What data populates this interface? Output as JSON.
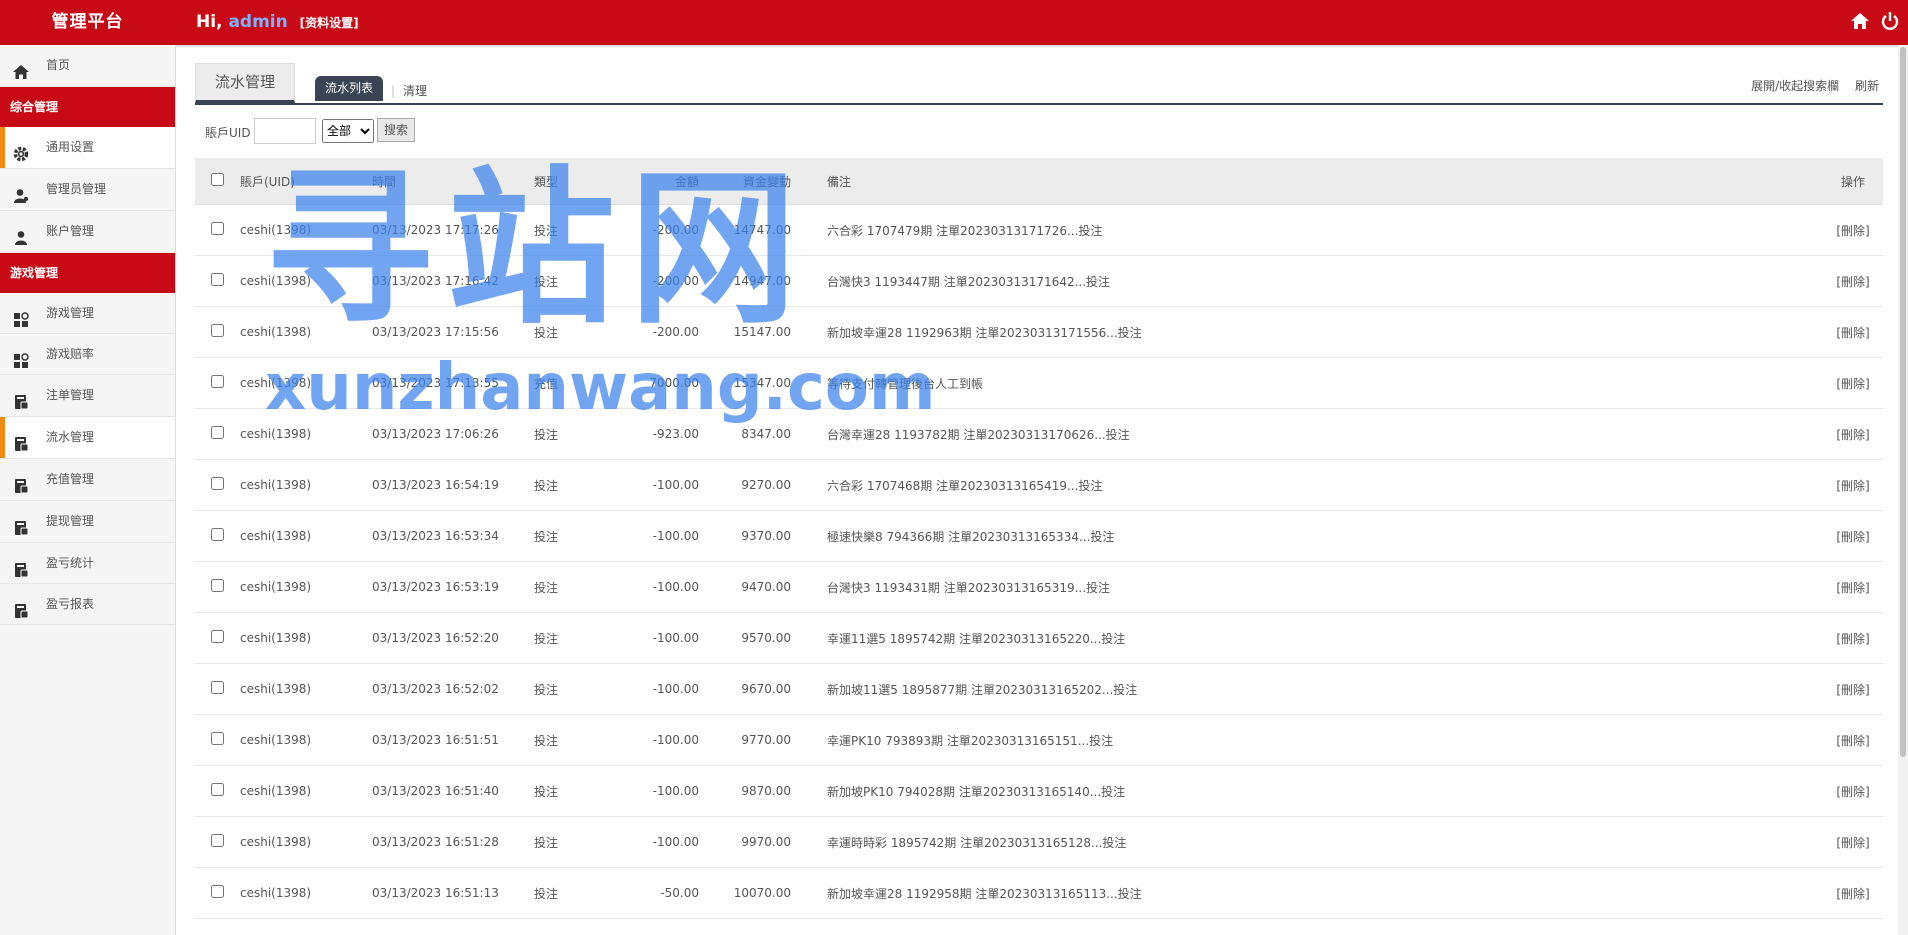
{
  "header": {
    "brand": "管理平台",
    "greeting": "Hi,",
    "user": "admin",
    "profile_link": "[资料设置]"
  },
  "sidebar": {
    "home": "首页",
    "section1": "综合管理",
    "items1": [
      {
        "label": "通用设置",
        "icon": "gear-icon"
      },
      {
        "label": "管理员管理",
        "icon": "user-icon"
      },
      {
        "label": "账户管理",
        "icon": "user-icon"
      }
    ],
    "section2": "游戏管理",
    "items2": [
      {
        "label": "游戏管理",
        "icon": "apps-icon"
      },
      {
        "label": "游戏赔率",
        "icon": "apps-icon"
      },
      {
        "label": "注单管理",
        "icon": "ledger-icon"
      },
      {
        "label": "流水管理",
        "icon": "ledger-icon"
      },
      {
        "label": "充值管理",
        "icon": "ledger-icon"
      },
      {
        "label": "提现管理",
        "icon": "ledger-icon"
      },
      {
        "label": "盈亏统计",
        "icon": "ledger-icon"
      },
      {
        "label": "盈亏报表",
        "icon": "ledger-icon"
      }
    ],
    "active": "流水管理"
  },
  "tabs": {
    "main": "流水管理",
    "sub": "流水列表",
    "clean": "清理",
    "toggle_search": "展開/收起搜索欄",
    "refresh": "刷新"
  },
  "search": {
    "label": "賬戶UID",
    "input_value": "",
    "select_value": "全部",
    "button": "搜索"
  },
  "table": {
    "headers": {
      "account": "賬戶(UID)",
      "time": "時間",
      "type": "類型",
      "amount": "金額",
      "balance": "資金變動",
      "note": "備注",
      "op": "操作"
    },
    "rows": [
      {
        "account": "ceshi(1398)",
        "time": "03/13/2023 17:17:26",
        "type": "投注",
        "amount": "-200.00",
        "balance": "14747.00",
        "note": "六合彩 1707479期 注單20230313171726...投注",
        "op": "[刪除]"
      },
      {
        "account": "ceshi(1398)",
        "time": "03/13/2023 17:16:42",
        "type": "投注",
        "amount": "-200.00",
        "balance": "14947.00",
        "note": "台灣快3 1193447期 注單20230313171642...投注",
        "op": "[刪除]"
      },
      {
        "account": "ceshi(1398)",
        "time": "03/13/2023 17:15:56",
        "type": "投注",
        "amount": "-200.00",
        "balance": "15147.00",
        "note": "新加坡幸運28 1192963期 注單20230313171556...投注",
        "op": "[刪除]"
      },
      {
        "account": "ceshi(1398)",
        "time": "03/13/2023 17:13:55",
        "type": "充值",
        "amount": "7000.00",
        "balance": "15347.00",
        "note": "等待支付轉管理後台人工到帳",
        "op": "[刪除]"
      },
      {
        "account": "ceshi(1398)",
        "time": "03/13/2023 17:06:26",
        "type": "投注",
        "amount": "-923.00",
        "balance": "8347.00",
        "note": "台灣幸運28 1193782期 注單20230313170626...投注",
        "op": "[刪除]"
      },
      {
        "account": "ceshi(1398)",
        "time": "03/13/2023 16:54:19",
        "type": "投注",
        "amount": "-100.00",
        "balance": "9270.00",
        "note": "六合彩 1707468期 注單20230313165419...投注",
        "op": "[刪除]"
      },
      {
        "account": "ceshi(1398)",
        "time": "03/13/2023 16:53:34",
        "type": "投注",
        "amount": "-100.00",
        "balance": "9370.00",
        "note": "極速快樂8 794366期 注單20230313165334...投注",
        "op": "[刪除]"
      },
      {
        "account": "ceshi(1398)",
        "time": "03/13/2023 16:53:19",
        "type": "投注",
        "amount": "-100.00",
        "balance": "9470.00",
        "note": "台灣快3 1193431期 注單20230313165319...投注",
        "op": "[刪除]"
      },
      {
        "account": "ceshi(1398)",
        "time": "03/13/2023 16:52:20",
        "type": "投注",
        "amount": "-100.00",
        "balance": "9570.00",
        "note": "幸運11選5 1895742期 注單20230313165220...投注",
        "op": "[刪除]"
      },
      {
        "account": "ceshi(1398)",
        "time": "03/13/2023 16:52:02",
        "type": "投注",
        "amount": "-100.00",
        "balance": "9670.00",
        "note": "新加坡11選5 1895877期 注單20230313165202...投注",
        "op": "[刪除]"
      },
      {
        "account": "ceshi(1398)",
        "time": "03/13/2023 16:51:51",
        "type": "投注",
        "amount": "-100.00",
        "balance": "9770.00",
        "note": "幸運PK10 793893期 注單20230313165151...投注",
        "op": "[刪除]"
      },
      {
        "account": "ceshi(1398)",
        "time": "03/13/2023 16:51:40",
        "type": "投注",
        "amount": "-100.00",
        "balance": "9870.00",
        "note": "新加坡PK10 794028期 注單20230313165140...投注",
        "op": "[刪除]"
      },
      {
        "account": "ceshi(1398)",
        "time": "03/13/2023 16:51:28",
        "type": "投注",
        "amount": "-100.00",
        "balance": "9970.00",
        "note": "幸運時時彩 1895742期 注單20230313165128...投注",
        "op": "[刪除]"
      },
      {
        "account": "ceshi(1398)",
        "time": "03/13/2023 16:51:13",
        "type": "投注",
        "amount": "-50.00",
        "balance": "10070.00",
        "note": "新加坡幸運28 1192958期 注單20230313165113...投注",
        "op": "[刪除]"
      }
    ]
  },
  "watermark": {
    "cn": "寻站网",
    "en": "xunzhanwang.com"
  },
  "colors": {
    "header_red": "#c80a16",
    "active_accent": "#f38b12",
    "tab_dark": "#3b4454",
    "bet_green": "#2e9a3f",
    "recharge_orange": "#f0820f",
    "watermark_blue": "#3c82eb"
  }
}
